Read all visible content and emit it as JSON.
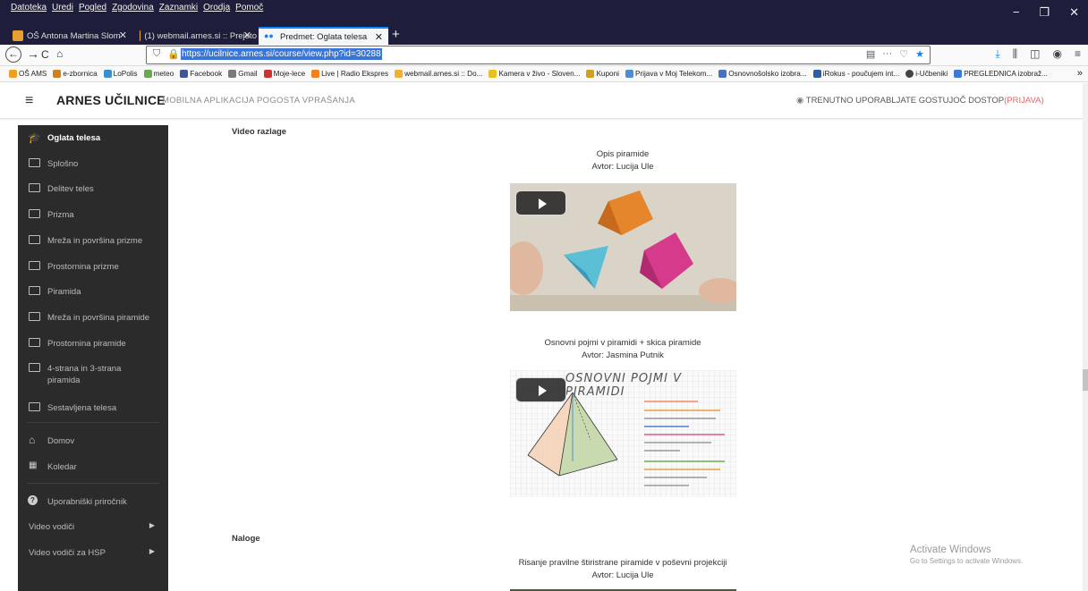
{
  "menubar": {
    "items": [
      "Datoteka",
      "Uredi",
      "Pogled",
      "Zgodovina",
      "Zaznamki",
      "Orodja",
      "Pomoč"
    ],
    "controls": {
      "minimize": "−",
      "restore": "❐",
      "close": "✕"
    }
  },
  "tabs": [
    {
      "label": "OŠ Antona Martina Slomška Vr",
      "close": "✕"
    },
    {
      "label": "(1) webmail.arnes.si :: Prejeto",
      "close": "✕"
    },
    {
      "label": "Predmet: Oglata telesa",
      "close": "✕"
    }
  ],
  "newtab": "+",
  "nav": {
    "url": "https://ucilnice.arnes.si/course/view.php?id=30288",
    "more": "···"
  },
  "bookmarks": {
    "items": [
      {
        "label": "OŠ AMS",
        "color": "#f0a020"
      },
      {
        "label": "e-zbornica",
        "color": "#d08020"
      },
      {
        "label": "LoPolis",
        "color": "#3a8fd0"
      },
      {
        "label": "meteo",
        "color": "#6aa84f"
      },
      {
        "label": "Facebook",
        "color": "#3b5998"
      },
      {
        "label": "Gmail",
        "color": "#7a7a7a"
      },
      {
        "label": "Moje-lece",
        "color": "#cc3333"
      },
      {
        "label": "Live | Radio Ekspres",
        "color": "#f08020"
      },
      {
        "label": "webmail.arnes.si :: Do...",
        "color": "#f0b030"
      },
      {
        "label": "Kamera v živo - Sloven...",
        "color": "#e8c020"
      },
      {
        "label": "Kuponi",
        "color": "#d0a020"
      },
      {
        "label": "Prijava v Moj Telekom...",
        "color": "#4a90d0"
      },
      {
        "label": "Osnovnošolsko izobra...",
        "color": "#4a70c0"
      },
      {
        "label": "iRokus - poučujem int...",
        "color": "#2a60a0"
      },
      {
        "label": "i-Učbeniki",
        "color": "#444444"
      },
      {
        "label": "PREGLEDNICA izobraž...",
        "color": "#3a7bd5"
      }
    ],
    "more": "»"
  },
  "header": {
    "brand": "ARNES UČILNICE",
    "links": [
      "MOBILNA APLIKACIJA",
      "POGOSTA VPRAŠANJA"
    ],
    "guest": "TRENUTNO UPORABLJATE GOSTUJOČ DOSTOP",
    "login": "(PRIJAVA)"
  },
  "sidebar": {
    "course": "Oglata telesa",
    "sections": [
      "Splošno",
      "Delitev teles",
      "Prizma",
      "Mreža in površina prizme",
      "Prostornina prizme",
      "Piramida",
      "Mreža in površina piramide",
      "Prostornina piramide",
      "4-strana in 3-strana piramida",
      "Sestavljena telesa"
    ],
    "nav": [
      "Domov",
      "Koledar"
    ],
    "help": "Uporabniški priročnik",
    "guides": [
      "Video vodiči",
      "Video vodiči za HSP"
    ]
  },
  "main": {
    "section1": "Video razlage",
    "video1": {
      "title": "Opis piramide",
      "author": "Avtor: Lucija Ule"
    },
    "video2": {
      "title": "Osnovni pojmi v piramidi + skica piramide",
      "author": "Avtor: Jasmina Putnik",
      "slide_heading": "OSNOVNI POJMI V PIRAMIDI"
    },
    "section2": "Naloge",
    "video3": {
      "title": "Risanje pravilne štiristrane piramide v poševni projekciji",
      "author": "Avtor: Lucija Ule"
    }
  },
  "watermark": {
    "line1": "Activate Windows",
    "line2": "Go to Settings to activate Windows."
  },
  "colors": {
    "chrome_dark": "#1e1e3c",
    "sidebar_bg": "#2b2b2b",
    "accent_blue": "#0a84ff",
    "login_red": "#e06666"
  }
}
